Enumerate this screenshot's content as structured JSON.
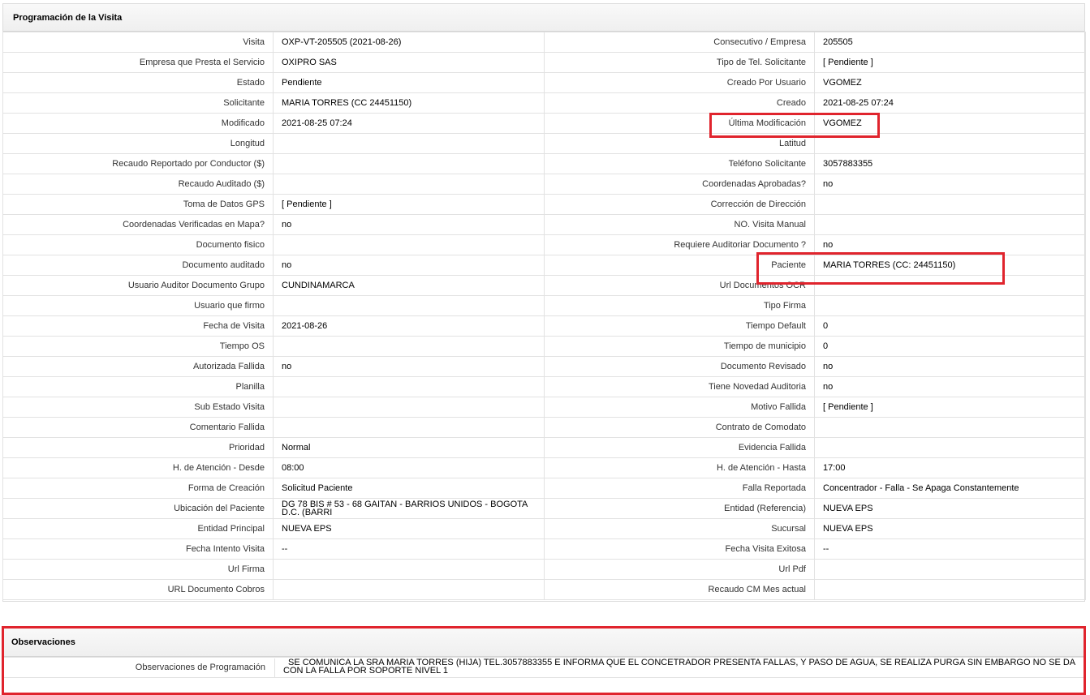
{
  "programacion": {
    "title": "Programación de la Visita",
    "rows": [
      {
        "l1": "Visita",
        "v1": "OXP-VT-205505 (2021-08-26)",
        "l2": "Consecutivo / Empresa",
        "v2": "205505"
      },
      {
        "l1": "Empresa que Presta el Servicio",
        "v1": "OXIPRO SAS",
        "l2": "Tipo de Tel. Solicitante",
        "v2": "[ Pendiente ]"
      },
      {
        "l1": "Estado",
        "v1": "Pendiente",
        "l2": "Creado Por Usuario",
        "v2": "VGOMEZ"
      },
      {
        "l1": "Solicitante",
        "v1": "MARIA TORRES (CC 24451150)",
        "l2": "Creado",
        "v2": "2021-08-25 07:24"
      },
      {
        "l1": "Modificado",
        "v1": "2021-08-25 07:24",
        "l2": "Última Modificación",
        "v2": "VGOMEZ"
      },
      {
        "l1": "Longitud",
        "v1": "",
        "l2": "Latitud",
        "v2": ""
      },
      {
        "l1": "Recaudo Reportado por Conductor ($)",
        "v1": "",
        "l2": "Teléfono Solicitante",
        "v2": "3057883355"
      },
      {
        "l1": "Recaudo Auditado ($)",
        "v1": "",
        "l2": "Coordenadas Aprobadas?",
        "v2": "no"
      },
      {
        "l1": "Toma de Datos GPS",
        "v1": "[ Pendiente ]",
        "l2": "Corrección de Dirección",
        "v2": ""
      },
      {
        "l1": "Coordenadas Verificadas en Mapa?",
        "v1": "no",
        "l2": "NO. Visita Manual",
        "v2": ""
      },
      {
        "l1": "Documento fisico",
        "v1": "",
        "l2": "Requiere Auditoriar Documento ?",
        "v2": "no"
      },
      {
        "l1": "Documento auditado",
        "v1": "no",
        "l2": "Paciente",
        "v2": "MARIA TORRES (CC: 24451150)"
      },
      {
        "l1": "Usuario Auditor Documento Grupo",
        "v1": "CUNDINAMARCA",
        "l2": "Url Documentos OCR",
        "v2": ""
      },
      {
        "l1": "Usuario que firmo",
        "v1": "",
        "l2": "Tipo Firma",
        "v2": ""
      },
      {
        "l1": "Fecha de Visita",
        "v1": "2021-08-26",
        "l2": "Tiempo Default",
        "v2": "0"
      },
      {
        "l1": "Tiempo OS",
        "v1": "",
        "l2": "Tiempo de municipio",
        "v2": "0"
      },
      {
        "l1": "Autorizada Fallida",
        "v1": "no",
        "l2": "Documento Revisado",
        "v2": "no"
      },
      {
        "l1": "Planilla",
        "v1": "",
        "l2": "Tiene Novedad Auditoria",
        "v2": "no"
      },
      {
        "l1": "Sub Estado Visita",
        "v1": "",
        "l2": "Motivo Fallida",
        "v2": "[ Pendiente ]"
      },
      {
        "l1": "Comentario Fallida",
        "v1": "",
        "l2": "Contrato de Comodato",
        "v2": ""
      },
      {
        "l1": "Prioridad",
        "v1": "Normal",
        "l2": "Evidencia Fallida",
        "v2": ""
      },
      {
        "l1": "H. de Atención - Desde",
        "v1": "08:00",
        "l2": "H. de Atención - Hasta",
        "v2": "17:00"
      },
      {
        "l1": "Forma de Creación",
        "v1": "Solicitud Paciente",
        "l2": "Falla Reportada",
        "v2": "Concentrador - Falla - Se Apaga Constantemente"
      },
      {
        "l1": "Ubicación del Paciente",
        "v1": "DG 78 BIS # 53 - 68 GAITAN - BARRIOS UNIDOS - BOGOTA D.C. (BARRI",
        "l2": "Entidad (Referencia)",
        "v2": "NUEVA EPS"
      },
      {
        "l1": "Entidad Principal",
        "v1": "NUEVA EPS",
        "l2": "Sucursal",
        "v2": "NUEVA EPS"
      },
      {
        "l1": "Fecha Intento Visita",
        "v1": "--",
        "l2": "Fecha Visita Exitosa",
        "v2": "--"
      },
      {
        "l1": "Url Firma",
        "v1": "",
        "l2": "Url Pdf",
        "v2": ""
      },
      {
        "l1": "URL Documento Cobros",
        "v1": "",
        "l2": "Recaudo CM Mes actual",
        "v2": ""
      }
    ]
  },
  "observaciones": {
    "title": "Observaciones",
    "label": "Observaciones de Programación",
    "value": "SE COMUNICA LA SRA MARIA TORRES (HIJA) TEL.3057883355 E INFORMA QUE EL CONCETRADOR PRESENTA FALLAS, Y PASO DE AGUA, SE REALIZA PURGA SIN EMBARGO NO SE DA CON LA FALLA POR SOPORTE NIVEL 1"
  },
  "highlight_color": "#e0242d"
}
